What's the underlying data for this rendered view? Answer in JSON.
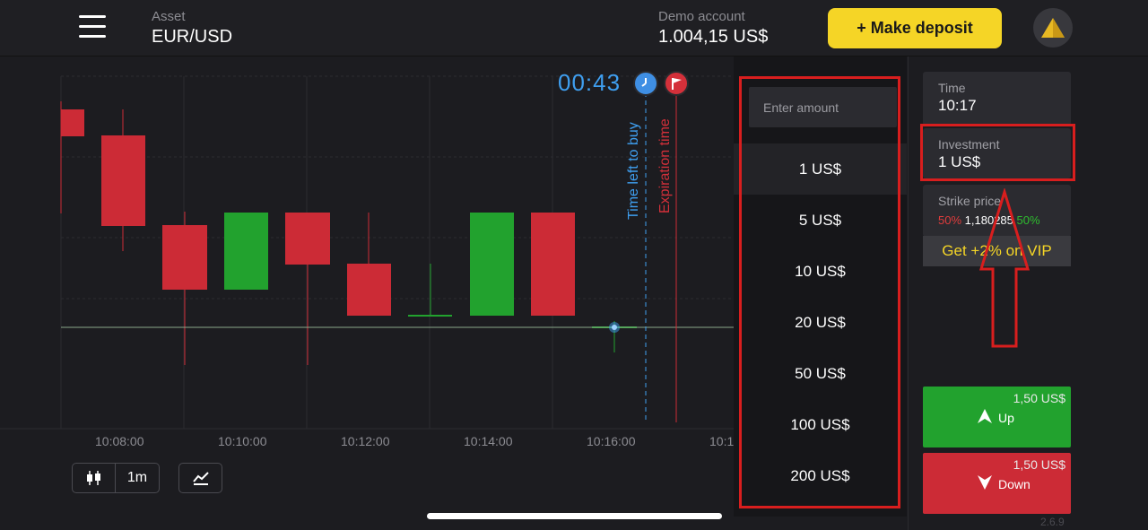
{
  "header": {
    "asset_label": "Asset",
    "asset_value": "EUR/USD",
    "account_label": "Demo account",
    "account_value": "1.004,15 US$",
    "deposit_label": "+ Make deposit"
  },
  "chart": {
    "timer": "00:43",
    "time_left_label": "Time left to buy",
    "expiration_label": "Expiration time",
    "time_ticks": [
      "10:08:00",
      "10:10:00",
      "10:12:00",
      "10:14:00",
      "10:16:00",
      "10:1"
    ],
    "toolbar": {
      "timeframe": "1m"
    },
    "colors": {
      "up": "#22a22e",
      "down": "#cc2b36",
      "timer": "#3f9ff0"
    }
  },
  "amount_panel": {
    "placeholder": "Enter amount",
    "items": [
      "1 US$",
      "5 US$",
      "10 US$",
      "20 US$",
      "50 US$",
      "100 US$",
      "200 US$"
    ],
    "selected": "1 US$"
  },
  "side_panel": {
    "time_label": "Time",
    "time_value": "10:17",
    "investment_label": "Investment",
    "investment_value": "1 US$",
    "strike_label": "Strike price",
    "strike_left_pct": "50%",
    "strike_price": "1,180285",
    "strike_right_pct": "50%",
    "vip_label": "Get +2% on VIP",
    "up_payout": "1,50 US$",
    "up_label": "Up",
    "down_payout": "1,50 US$",
    "down_label": "Down",
    "version": "2.6.9"
  }
}
